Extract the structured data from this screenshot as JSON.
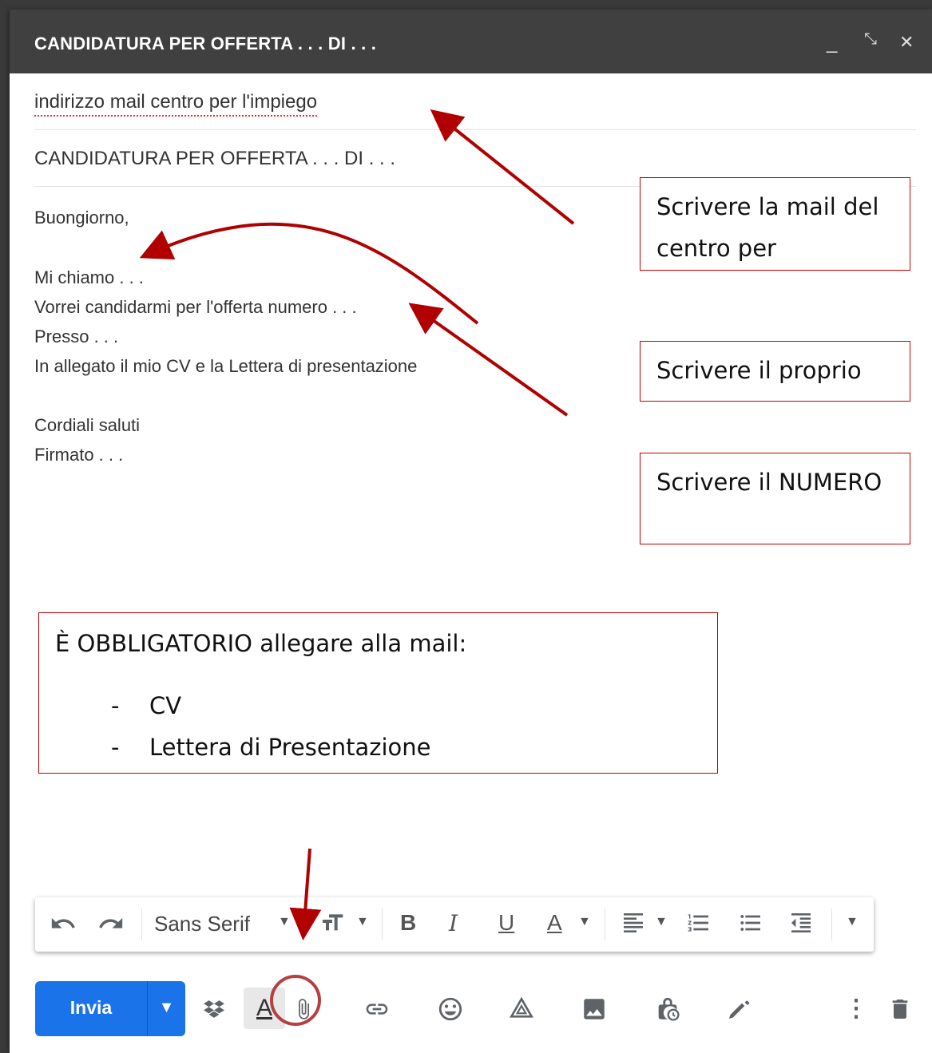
{
  "compose": {
    "title": "CANDIDATURA PER OFFERTA . . . DI . . .",
    "minimize_label": "_",
    "expand_label": "⤡",
    "close_label": "✕",
    "to_value": "indirizzo mail centro per l'impiego",
    "subject_value": "CANDIDATURA PER OFFERTA . . . DI . . .",
    "body_lines": [
      "Buongiorno,",
      "Mi chiamo . . .",
      "Vorrei candidarmi per l'offerta numero . . .",
      "Presso . . .",
      "In allegato il mio CV e la Lettera di presentazione",
      "Cordiali saluti",
      "Firmato . . ."
    ]
  },
  "annotations": {
    "note_mail": "Scrivere la mail del centro per",
    "note_name": "Scrivere il proprio",
    "note_number": "Scrivere il NUMERO",
    "note_attach_title": "È OBBLIGATORIO allegare alla mail:",
    "note_attach_items": [
      "CV",
      "Lettera di Presentazione"
    ],
    "arrow_color": "#b00000"
  },
  "format_toolbar": {
    "font_name": "Sans Serif",
    "icons": [
      "undo-icon",
      "redo-icon",
      "font-size-icon",
      "bold-icon",
      "italic-icon",
      "underline-icon",
      "text-color-icon",
      "align-icon",
      "numbered-list-icon",
      "bulleted-list-icon",
      "indent-less-icon",
      "more-formatting-icon"
    ],
    "bold_label": "B",
    "italic_label": "I",
    "underline_label": "U",
    "text_color_label": "A"
  },
  "bottom_toolbar": {
    "send_label": "Invia",
    "formatting_label": "A",
    "icons": [
      "dropbox-icon",
      "formatting-options-icon",
      "attach-file-icon",
      "insert-link-icon",
      "emoji-icon",
      "google-drive-icon",
      "insert-photo-icon",
      "confidential-mode-icon",
      "signature-icon",
      "more-options-icon",
      "discard-draft-icon"
    ]
  },
  "colors": {
    "title_bar": "#404040",
    "send_button": "#1a73e8",
    "annotation_red": "#c00000"
  }
}
